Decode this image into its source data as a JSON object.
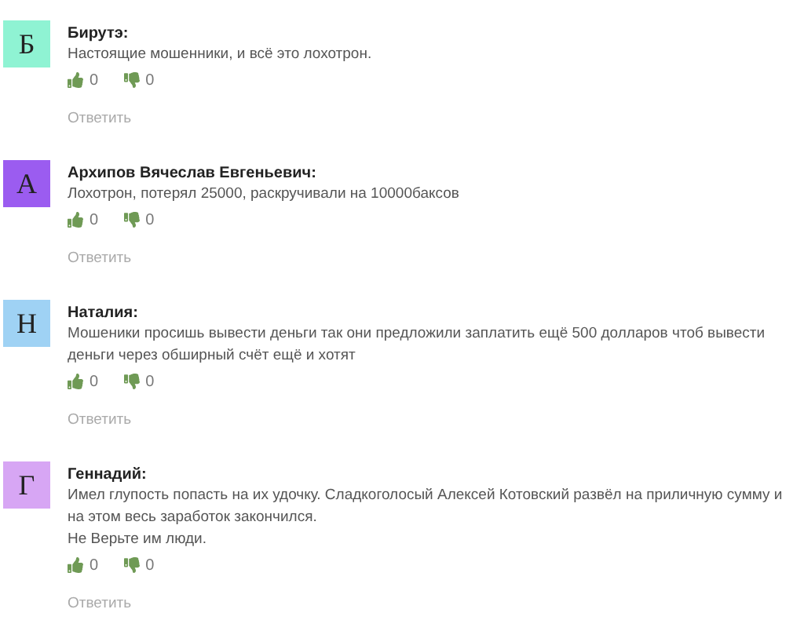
{
  "comments": [
    {
      "initial": "Б",
      "color": "#8ff3d3",
      "author": "Бирутэ:",
      "paragraphs": [
        "Настоящие мошенники, и всё это лохотрон."
      ],
      "likes": "0",
      "dislikes": "0",
      "reply": "Ответить"
    },
    {
      "initial": "А",
      "color": "#9b5cf0",
      "author": "Архипов Вячеслав Евгеньевич:",
      "paragraphs": [
        "Лохотрон, потерял 25000, раскручивали на 10000баксов"
      ],
      "likes": "0",
      "dislikes": "0",
      "reply": "Ответить"
    },
    {
      "initial": "Н",
      "color": "#9fd2f4",
      "author": "Наталия:",
      "paragraphs": [
        "Мошеники просишь вывести деньги так они предложили заплатить ещё 500 долларов чтоб вывести деньги через обширный счёт ещё и хотят"
      ],
      "likes": "0",
      "dislikes": "0",
      "reply": "Ответить"
    },
    {
      "initial": "Г",
      "color": "#d7a6f4",
      "author": "Геннадий:",
      "paragraphs": [
        "Имел глупость попасть на их удочку. Сладкоголосый Алексей Котовский развёл на приличную сумму и на этом весь заработок закончился.",
        "Не Верьте им люди."
      ],
      "likes": "0",
      "dislikes": "0",
      "reply": "Ответить"
    }
  ]
}
